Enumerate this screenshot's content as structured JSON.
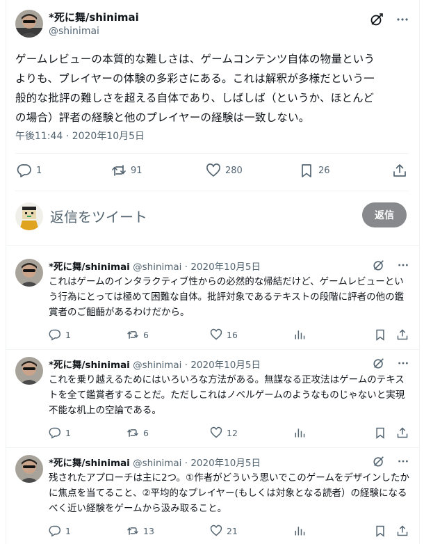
{
  "main": {
    "name": "*死に舞/shinimai",
    "handle": "@shinimai",
    "text": "ゲームレビューの本質的な難しさは、ゲームコンテンツ自体の物量という\nよりも、プレイヤーの体験の多彩さにある。これは解釈が多様だという一\n般的な批評の難しさを超える自体であり、しばしば（というか、ほとんど\nの場合）評者の経験と他のプレイヤーの経験は一致しない。",
    "timestamp": "午後11:44 · 2020年10月5日",
    "replies": "1",
    "retweets": "91",
    "likes": "280",
    "bookmarks": "26"
  },
  "compose": {
    "placeholder": "返信をツイート",
    "button": "返信"
  },
  "thread": [
    {
      "name": "*死に舞/shinimai",
      "handle": "@shinimai",
      "sep": "·",
      "date": "2020年10月5日",
      "text": "これはゲームのインタラクティブ性からの必然的な帰結だけど、ゲームレビューという行為にとっては極めて困難な自体。批評対象であるテキストの段階に評者の他の鑑賞者のご齟齬があるわけだから。",
      "replies": "1",
      "retweets": "6",
      "likes": "16"
    },
    {
      "name": "*死に舞/shinimai",
      "handle": "@shinimai",
      "sep": "·",
      "date": "2020年10月5日",
      "text": "これを乗り越えるためにはいろいろな方法がある。無謀なる正攻法はゲームのテキストを全て鑑賞者することだ。ただしこれはノベルゲームのようなものじゃないと実現不能な机上の空論である。",
      "replies": "1",
      "retweets": "6",
      "likes": "12"
    },
    {
      "name": "*死に舞/shinimai",
      "handle": "@shinimai",
      "sep": "·",
      "date": "2020年10月5日",
      "text": "残されたアプローチは主に2つ。①作者がどういう思いでこのゲームをデザインしたかに焦点を当てること、②平均的なプレイヤー(もしくは対象となる読者）の経験になるべく近い経験をゲームから汲み取ること。",
      "replies": "1",
      "retweets": "13",
      "likes": "21"
    }
  ],
  "icons": {
    "grok": "grok-icon",
    "more": "more-icon",
    "reply": "reply-icon",
    "retweet": "retweet-icon",
    "like": "heart-icon",
    "bookmark": "bookmark-icon",
    "share": "share-icon",
    "views": "views-icon"
  },
  "colors": {
    "text": "#0f1419",
    "secondary": "#536471",
    "button_disabled": "#87898c",
    "divider": "#eff3f4"
  }
}
